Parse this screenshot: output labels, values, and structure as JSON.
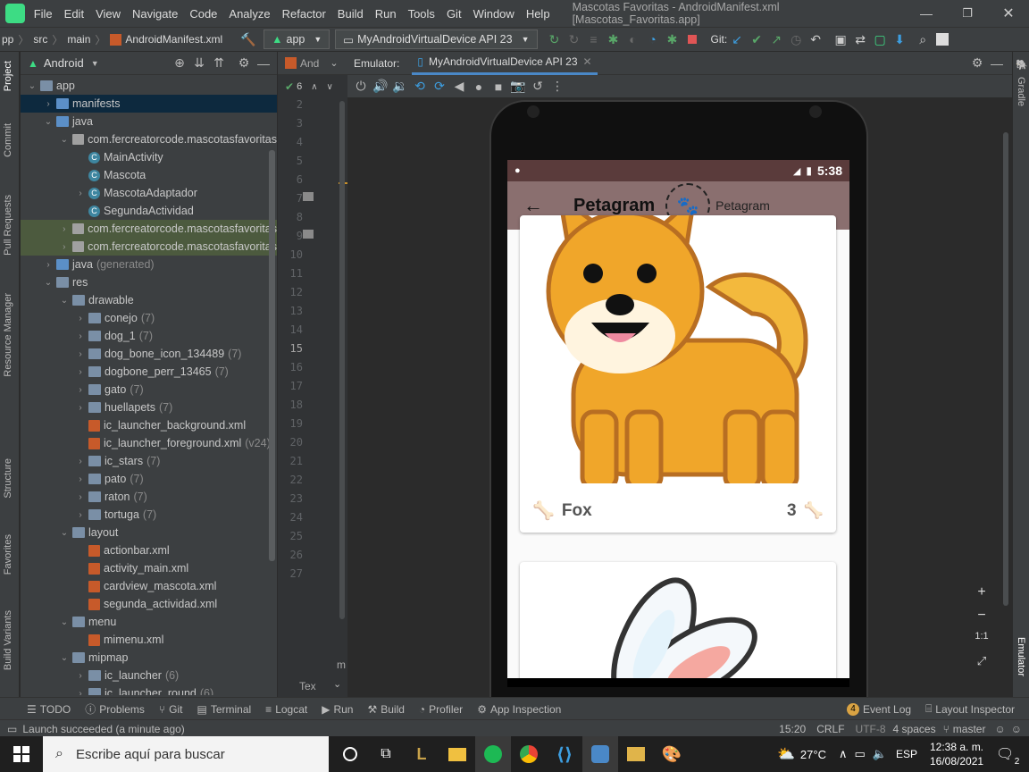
{
  "menubar": {
    "items": [
      "File",
      "Edit",
      "View",
      "Navigate",
      "Code",
      "Analyze",
      "Refactor",
      "Build",
      "Run",
      "Tools",
      "Git",
      "Window",
      "Help"
    ],
    "title": "Mascotas Favoritas - AndroidManifest.xml [Mascotas_Favoritas.app]"
  },
  "navbar": {
    "breadcrumb": [
      "pp",
      "src",
      "main",
      "AndroidManifest.xml"
    ],
    "run_config": "app",
    "device": "MyAndroidVirtualDevice API 23",
    "git_label": "Git:"
  },
  "leftstrip": [
    "Project",
    "Commit",
    "Pull Requests",
    "Resource Manager",
    "Structure",
    "Favorites",
    "Build Variants"
  ],
  "project": {
    "view": "Android",
    "tree": [
      {
        "indent": 0,
        "arrow": "v",
        "icon": "folder",
        "label": "app",
        "count": ""
      },
      {
        "indent": 1,
        "arrow": ">",
        "icon": "folder-java",
        "label": "manifests",
        "count": "",
        "state": "sel"
      },
      {
        "indent": 1,
        "arrow": "v",
        "icon": "folder-java",
        "label": "java",
        "count": ""
      },
      {
        "indent": 2,
        "arrow": "v",
        "icon": "pkg",
        "label": "com.fercreatorcode.mascotasfavoritas",
        "count": ""
      },
      {
        "indent": 3,
        "arrow": "",
        "icon": "cls",
        "label": "MainActivity",
        "count": ""
      },
      {
        "indent": 3,
        "arrow": "",
        "icon": "cls",
        "label": "Mascota",
        "count": ""
      },
      {
        "indent": 3,
        "arrow": ">",
        "icon": "cls",
        "label": "MascotaAdaptador",
        "count": ""
      },
      {
        "indent": 3,
        "arrow": "",
        "icon": "cls",
        "label": "SegundaActividad",
        "count": ""
      },
      {
        "indent": 2,
        "arrow": ">",
        "icon": "pkg",
        "label": "com.fercreatorcode.mascotasfavoritas",
        "count": "",
        "state": "hl"
      },
      {
        "indent": 2,
        "arrow": ">",
        "icon": "pkg",
        "label": "com.fercreatorcode.mascotasfavoritas",
        "count": "",
        "state": "hl"
      },
      {
        "indent": 1,
        "arrow": ">",
        "icon": "folder-java",
        "label": "java",
        "count": "(generated)"
      },
      {
        "indent": 1,
        "arrow": "v",
        "icon": "folder",
        "label": "res",
        "count": ""
      },
      {
        "indent": 2,
        "arrow": "v",
        "icon": "folder",
        "label": "drawable",
        "count": ""
      },
      {
        "indent": 3,
        "arrow": ">",
        "icon": "folder",
        "label": "conejo",
        "count": "(7)"
      },
      {
        "indent": 3,
        "arrow": ">",
        "icon": "folder",
        "label": "dog_1",
        "count": "(7)"
      },
      {
        "indent": 3,
        "arrow": ">",
        "icon": "folder",
        "label": "dog_bone_icon_134489",
        "count": "(7)"
      },
      {
        "indent": 3,
        "arrow": ">",
        "icon": "folder",
        "label": "dogbone_perr_13465",
        "count": "(7)"
      },
      {
        "indent": 3,
        "arrow": ">",
        "icon": "folder",
        "label": "gato",
        "count": "(7)"
      },
      {
        "indent": 3,
        "arrow": ">",
        "icon": "folder",
        "label": "huellapets",
        "count": "(7)"
      },
      {
        "indent": 3,
        "arrow": "",
        "icon": "xml",
        "label": "ic_launcher_background.xml",
        "count": ""
      },
      {
        "indent": 3,
        "arrow": "",
        "icon": "xml",
        "label": "ic_launcher_foreground.xml",
        "count": "(v24)"
      },
      {
        "indent": 3,
        "arrow": ">",
        "icon": "folder",
        "label": "ic_stars",
        "count": "(7)"
      },
      {
        "indent": 3,
        "arrow": ">",
        "icon": "folder",
        "label": "pato",
        "count": "(7)"
      },
      {
        "indent": 3,
        "arrow": ">",
        "icon": "folder",
        "label": "raton",
        "count": "(7)"
      },
      {
        "indent": 3,
        "arrow": ">",
        "icon": "folder",
        "label": "tortuga",
        "count": "(7)"
      },
      {
        "indent": 2,
        "arrow": "v",
        "icon": "folder",
        "label": "layout",
        "count": ""
      },
      {
        "indent": 3,
        "arrow": "",
        "icon": "xml",
        "label": "actionbar.xml",
        "count": ""
      },
      {
        "indent": 3,
        "arrow": "",
        "icon": "xml",
        "label": "activity_main.xml",
        "count": ""
      },
      {
        "indent": 3,
        "arrow": "",
        "icon": "xml",
        "label": "cardview_mascota.xml",
        "count": ""
      },
      {
        "indent": 3,
        "arrow": "",
        "icon": "xml",
        "label": "segunda_actividad.xml",
        "count": ""
      },
      {
        "indent": 2,
        "arrow": "v",
        "icon": "folder",
        "label": "menu",
        "count": ""
      },
      {
        "indent": 3,
        "arrow": "",
        "icon": "xml",
        "label": "mimenu.xml",
        "count": ""
      },
      {
        "indent": 2,
        "arrow": "v",
        "icon": "folder",
        "label": "mipmap",
        "count": ""
      },
      {
        "indent": 3,
        "arrow": ">",
        "icon": "folder",
        "label": "ic_launcher",
        "count": "(6)"
      },
      {
        "indent": 3,
        "arrow": ">",
        "icon": "folder",
        "label": "ic_launcher_round",
        "count": "(6)"
      }
    ]
  },
  "editor": {
    "tab": "And",
    "problems": "6",
    "lines": [
      "2",
      "3",
      "4",
      "5",
      "6",
      "7",
      "8",
      "9",
      "10",
      "11",
      "12",
      "13",
      "14",
      "15",
      "16",
      "17",
      "18",
      "19",
      "20",
      "21",
      "22",
      "23",
      "24",
      "25",
      "26",
      "27"
    ],
    "current_line": "15",
    "bottom_tab": "Tex",
    "m_label": "m"
  },
  "emulator": {
    "label": "Emulator:",
    "tab": "MyAndroidVirtualDevice API 23"
  },
  "rightstrip": [
    "Gradle",
    "Emulator"
  ],
  "phone": {
    "time": "5:38",
    "app_title": "Petagram",
    "logo_label": "Petagram",
    "card1": {
      "name": "Fox",
      "likes": "3"
    }
  },
  "zoom": [
    "+",
    "−",
    "1:1",
    "⤢"
  ],
  "bottom_tools": [
    "TODO",
    "Problems",
    "Git",
    "Terminal",
    "Logcat",
    "Run",
    "Build",
    "Profiler",
    "App Inspection"
  ],
  "bottom_right_tools": {
    "event_count": "4",
    "event_log": "Event Log",
    "layout_inspector": "Layout Inspector"
  },
  "status": {
    "message": "Launch succeeded (a minute ago)",
    "position": "15:20",
    "line_sep": "CRLF",
    "encoding": "UTF-8",
    "indent": "4 spaces",
    "branch": "master"
  },
  "taskbar": {
    "search_placeholder": "Escribe aquí para buscar",
    "temperature": "27°C",
    "lang": "ESP",
    "time": "12:38 a. m.",
    "date": "16/08/2021",
    "notif_count": "2"
  }
}
